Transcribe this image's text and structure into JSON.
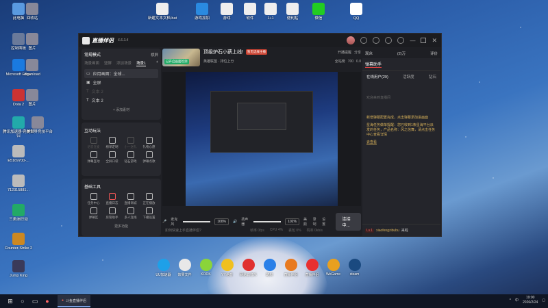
{
  "desktop_icons_left": [
    {
      "label": "此电脑"
    },
    {
      "label": "控制面板"
    },
    {
      "label": "Microsoft Edge"
    },
    {
      "label": "Dota 2"
    },
    {
      "label": "腾讯加速器-一键回归"
    },
    {
      "label": "E5169700-..."
    },
    {
      "label": "712315881..."
    },
    {
      "label": "三角洲行动"
    },
    {
      "label": "Counter-Strike 2"
    },
    {
      "label": "Jump King"
    }
  ],
  "desktop_icons_col2": [
    {
      "label": "回收站"
    },
    {
      "label": "图片"
    },
    {
      "label": "download"
    },
    {
      "label": "图片"
    },
    {
      "label": "完美世界竞技平台"
    }
  ],
  "desktop_icons_top": [
    {
      "label": "新建文本文档.bat"
    },
    {
      "label": "游戏加加"
    },
    {
      "label": "游戏"
    },
    {
      "label": "软件"
    },
    {
      "label": "1+1"
    },
    {
      "label": "便利贴"
    },
    {
      "label": "微信"
    },
    {
      "label": "QQ"
    }
  ],
  "window": {
    "app_name": "直播伴侣",
    "version": "6.5.3.4",
    "stream_title": "顶级炉石小薪上线!",
    "title_badge": "暂无选择主播",
    "category": "英雄联盟 · 排位上分",
    "thumb_label": "已开启画面检测",
    "top_actions": [
      "开播提醒",
      "分享"
    ],
    "stats": [
      "全站榜",
      "700",
      "0.0"
    ]
  },
  "left_panel": {
    "mode_label": "常规模式",
    "mode_extra": "横屏",
    "scene_tabs": [
      "场景画面",
      "竖屏",
      "添加场景",
      "场景1"
    ],
    "sources": [
      {
        "label": "应用画面：全球..."
      },
      {
        "label": "全屏"
      },
      {
        "label": "文本 2"
      },
      {
        "label": "文本 2"
      }
    ],
    "add_source": "+ 添加素材",
    "interactive_title": "互动玩法",
    "interactive": [
      "语音连麦",
      "榜单定制",
      "小一送礼",
      "礼物心愿",
      "弹幕互动",
      "全屏口袋",
      "钻石游戏",
      "弹幕点歌"
    ],
    "tools_title": "基础工具",
    "tools": [
      "任务中心",
      "直播日志",
      "直播商城",
      "正在播放",
      "弹幕区",
      "房管助手",
      "多人连线",
      "下播设置"
    ],
    "more": "更多功能"
  },
  "controls": {
    "mic_label": "麦克风",
    "mic_value": "100%",
    "mic_level": 1.0,
    "spk_label": "扬声器",
    "spk_value": "102%",
    "spk_level": 1.0,
    "buttons": [
      "美颜",
      "录制",
      "设置"
    ],
    "go_live": "连接中..."
  },
  "right_panel": {
    "tabs": [
      "弹幕助手"
    ],
    "top_tabs": [
      "观众",
      "(2)万",
      "评价"
    ],
    "sub_tabs": [
      "在线用户(29)",
      "活跃度",
      "钻石"
    ],
    "messages": [
      {
        "text": "欢迎来到直播间",
        "type": "normal"
      },
      {
        "text": "新增弹幕配置完成，点击弹幕添加进画面",
        "type": "warn"
      },
      {
        "text": "星海任务做单提醒：您已收到1条星海平台派发的任务，产品名称：风之信舞，请点击任务中心查看详情",
        "type": "hl"
      },
      {
        "text": "去查看",
        "type": "warn"
      }
    ],
    "bottom_tag": "Lv.1",
    "bottom_user": "xiaofengzibubu",
    "bottom_text": "来啦"
  },
  "status": {
    "hint": "如何快速上手直播伴侣?",
    "metrics": [
      "帧率 0fps",
      "CPU 4%",
      "丢包 0%",
      "码率 0kb/s"
    ]
  },
  "dock": [
    {
      "label": "UU加速器",
      "color": "#1ea0e8"
    },
    {
      "label": "效果文件",
      "color": "#e8e8e8"
    },
    {
      "label": "KOOK",
      "color": "#8ad43a"
    },
    {
      "label": "YY语音",
      "color": "#f0c020"
    },
    {
      "label": "网易云音乐",
      "color": "#e03030"
    },
    {
      "label": "酷狗",
      "color": "#2a80e8"
    },
    {
      "label": "直播伴侣",
      "color": "#e87a20"
    },
    {
      "label": "直播伴侣",
      "color": "#e83030"
    },
    {
      "label": "WeGame",
      "color": "#e8a020"
    },
    {
      "label": "steam",
      "color": "#1a4a80"
    }
  ],
  "taskbar": {
    "app_label": "斗鱼直播伴侣",
    "ime": "中",
    "time": "19:00",
    "date": "2026/2/24"
  }
}
